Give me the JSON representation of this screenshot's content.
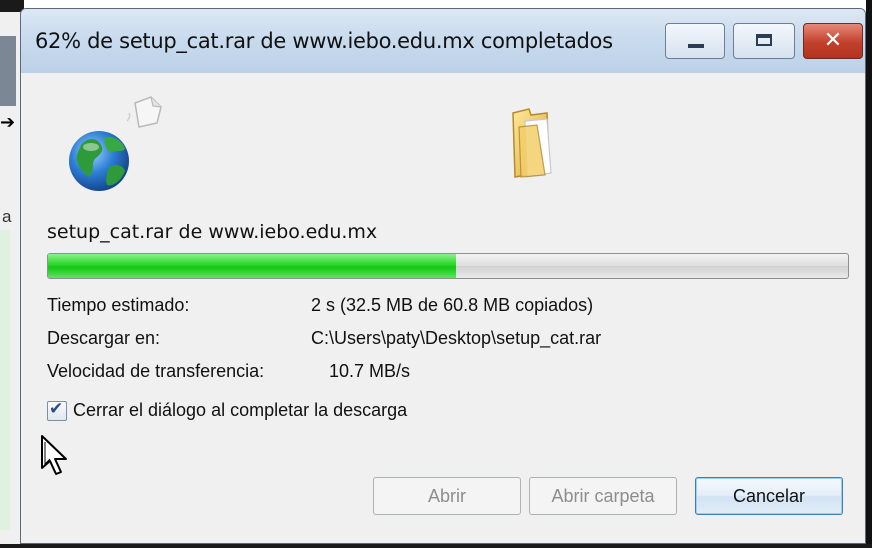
{
  "background": {
    "fragment_text": "a"
  },
  "window": {
    "title": "62% de setup_cat.rar de www.iebo.edu.mx completados",
    "controls": {
      "close_glyph": "✕"
    }
  },
  "download": {
    "file_label": "setup_cat.rar de www.iebo.edu.mx",
    "progress_fraction": 0.51,
    "info": [
      {
        "label": "Tiempo estimado:",
        "value": "2 s (32.5 MB de 60.8 MB copiados)"
      },
      {
        "label": "Descargar en:",
        "value": "C:\\Users\\paty\\Desktop\\setup_cat.rar"
      },
      {
        "label": "Velocidad de transferencia:",
        "value": "10.7 MB/s"
      }
    ],
    "close_on_complete": {
      "label": "Cerrar el diálogo al completar la descarga",
      "checked": true,
      "tick": "✔"
    }
  },
  "buttons": {
    "open": "Abrir",
    "open_folder": "Abrir carpeta",
    "cancel": "Cancelar"
  },
  "icons": [
    "globe-icon",
    "document-icon",
    "folder-icon",
    "pointer-cursor-icon",
    "arrow-icon"
  ],
  "colors": {
    "progress": "#22cc22",
    "titlebar": "#c9dbee",
    "close_button": "#c2402c"
  }
}
